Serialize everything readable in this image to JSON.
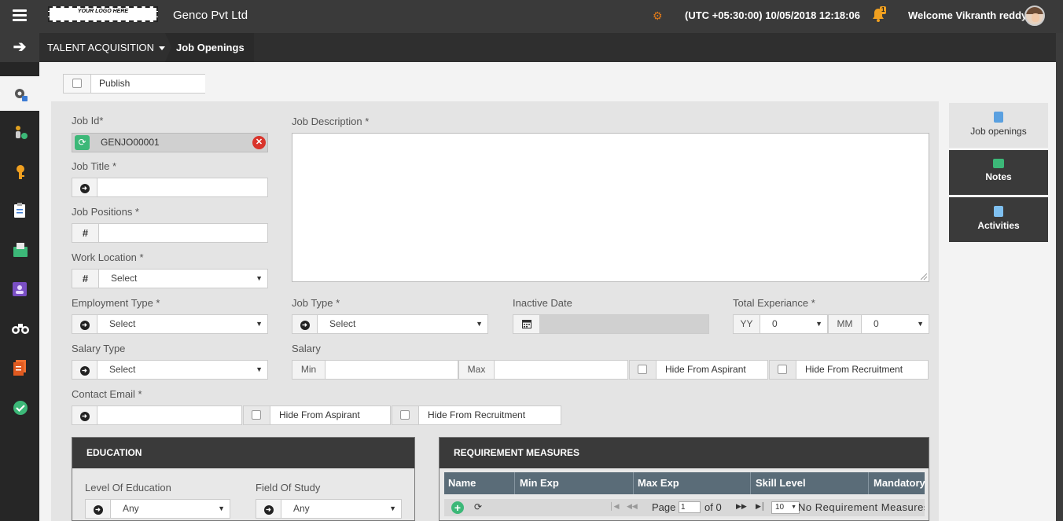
{
  "header": {
    "logo_text": "YOUR LOGO HERE",
    "company": "Genco Pvt Ltd",
    "datetime": "(UTC +05:30:00) 10/05/2018 12:18:06",
    "notification_count": "1",
    "welcome": "Welcome Vikranth reddy"
  },
  "subbar": {
    "module": "TALENT ACQUISITION",
    "breadcrumb": "Job Openings"
  },
  "publish": {
    "label": "Publish"
  },
  "form": {
    "job_id_label": "Job Id*",
    "job_id_value": "GENJO00001",
    "job_title_label": "Job Title *",
    "job_positions_label": "Job Positions *",
    "work_location_label": "Work Location *",
    "work_location_value": "Select",
    "job_description_label": "Job Description *",
    "employment_type_label": "Employment Type *",
    "employment_type_value": "Select",
    "job_type_label": "Job Type *",
    "job_type_value": "Select",
    "inactive_date_label": "Inactive Date",
    "total_experience_label": "Total Experiance *",
    "yy_label": "YY",
    "yy_value": "0",
    "mm_label": "MM",
    "mm_value": "0",
    "salary_type_label": "Salary Type",
    "salary_type_value": "Select",
    "salary_label": "Salary",
    "min_label": "Min",
    "max_label": "Max",
    "hide_from_aspirant": "Hide From Aspirant",
    "hide_from_recruitment": "Hide From Recruitment",
    "contact_email_label": "Contact Email *"
  },
  "education": {
    "title": "EDUCATION",
    "level_label": "Level Of Education",
    "level_value": "Any",
    "field_label": "Field Of Study",
    "field_value": "Any"
  },
  "requirements": {
    "title": "REQUIREMENT MEASURES",
    "columns": [
      "Name",
      "Min Exp",
      "Max Exp",
      "Skill Level",
      "Mandatory"
    ],
    "pager_page": "Page",
    "pager_page_value": "1",
    "pager_of": "of 0",
    "pager_size": "10",
    "empty_text": "No Requirement Measures are Av"
  },
  "right_tabs": [
    {
      "label": "Job openings",
      "icon": "document-icon"
    },
    {
      "label": "Notes",
      "icon": "chat-icon"
    },
    {
      "label": "Activities",
      "icon": "file-icon"
    }
  ],
  "colors": {
    "topbar": "#3a3a3a",
    "sidebar": "#262626",
    "grid_header": "#5a6c78",
    "accent_orange": "#f0a020",
    "reset_green": "#3cb878",
    "clear_red": "#d9342b"
  }
}
